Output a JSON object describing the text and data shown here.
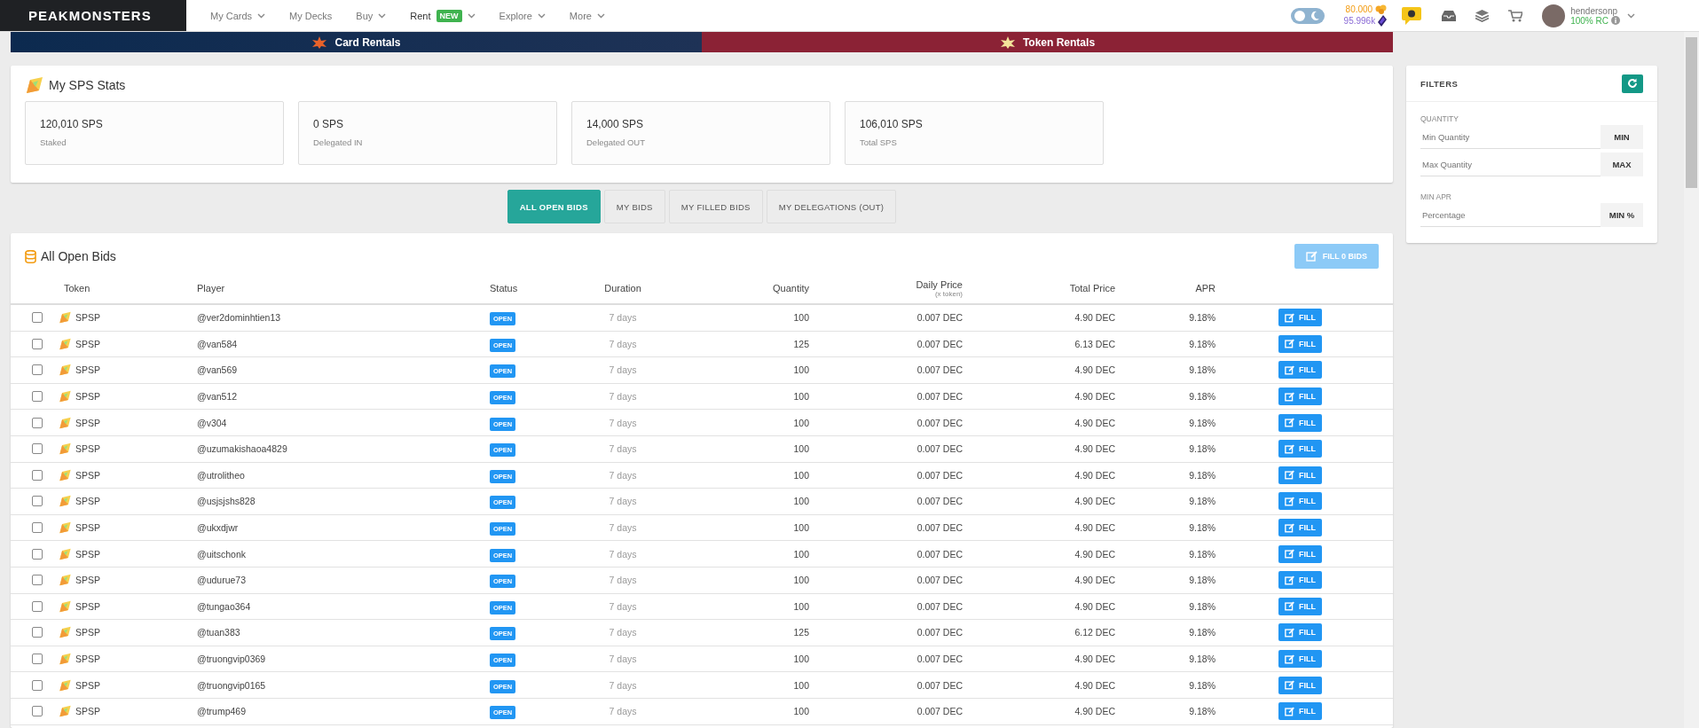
{
  "brand": {
    "name": "PEAKMONSTERS"
  },
  "nav": [
    {
      "label": "My Cards",
      "dropdown": true,
      "selected": false
    },
    {
      "label": "My Decks",
      "dropdown": false,
      "selected": false
    },
    {
      "label": "Buy",
      "dropdown": true,
      "selected": false
    },
    {
      "label": "Rent",
      "badge": "NEW",
      "dropdown": true,
      "selected": true
    },
    {
      "label": "Explore",
      "dropdown": true,
      "selected": false
    },
    {
      "label": "More",
      "dropdown": true,
      "selected": false
    }
  ],
  "header": {
    "dark_mode": false,
    "balance_primary": "80.000",
    "balance_secondary": "95.996k",
    "username": "hendersonp",
    "rc": "100% RC"
  },
  "banners": [
    {
      "label": "Card Rentals"
    },
    {
      "label": "Token Rentals"
    }
  ],
  "stats": {
    "title": "My SPS Stats",
    "items": [
      {
        "value": "120,010 SPS",
        "label": "Staked"
      },
      {
        "value": "0 SPS",
        "label": "Delegated IN"
      },
      {
        "value": "14,000 SPS",
        "label": "Delegated OUT"
      },
      {
        "value": "106,010 SPS",
        "label": "Total SPS"
      }
    ]
  },
  "tabs": [
    {
      "label": "ALL OPEN BIDS",
      "selected": true
    },
    {
      "label": "MY BIDS",
      "selected": false
    },
    {
      "label": "MY FILLED BIDS",
      "selected": false
    },
    {
      "label": "MY DELEGATIONS (OUT)",
      "selected": false
    }
  ],
  "bids": {
    "title": "All Open Bids",
    "fill_button": "FILL 0 BIDS",
    "fill_button_disabled": true,
    "columns": [
      "Token",
      "Player",
      "Status",
      "Duration",
      "Quantity",
      "Daily Price",
      "Total Price",
      "APR"
    ],
    "daily_price_note": "(x token)",
    "rows": [
      {
        "checked": false,
        "token": "SPSP",
        "player": "@ver2dominhtien13",
        "status": "OPEN",
        "duration": "7 days",
        "quantity": "100",
        "daily_price": "0.007 DEC",
        "total_price": "4.90 DEC",
        "apr": "9.18%",
        "action": "FILL"
      },
      {
        "checked": false,
        "token": "SPSP",
        "player": "@van584",
        "status": "OPEN",
        "duration": "7 days",
        "quantity": "125",
        "daily_price": "0.007 DEC",
        "total_price": "6.13 DEC",
        "apr": "9.18%",
        "action": "FILL"
      },
      {
        "checked": false,
        "token": "SPSP",
        "player": "@van569",
        "status": "OPEN",
        "duration": "7 days",
        "quantity": "100",
        "daily_price": "0.007 DEC",
        "total_price": "4.90 DEC",
        "apr": "9.18%",
        "action": "FILL"
      },
      {
        "checked": false,
        "token": "SPSP",
        "player": "@van512",
        "status": "OPEN",
        "duration": "7 days",
        "quantity": "100",
        "daily_price": "0.007 DEC",
        "total_price": "4.90 DEC",
        "apr": "9.18%",
        "action": "FILL"
      },
      {
        "checked": false,
        "token": "SPSP",
        "player": "@v304",
        "status": "OPEN",
        "duration": "7 days",
        "quantity": "100",
        "daily_price": "0.007 DEC",
        "total_price": "4.90 DEC",
        "apr": "9.18%",
        "action": "FILL"
      },
      {
        "checked": false,
        "token": "SPSP",
        "player": "@uzumakishaoa4829",
        "status": "OPEN",
        "duration": "7 days",
        "quantity": "100",
        "daily_price": "0.007 DEC",
        "total_price": "4.90 DEC",
        "apr": "9.18%",
        "action": "FILL"
      },
      {
        "checked": false,
        "token": "SPSP",
        "player": "@utrolitheo",
        "status": "OPEN",
        "duration": "7 days",
        "quantity": "100",
        "daily_price": "0.007 DEC",
        "total_price": "4.90 DEC",
        "apr": "9.18%",
        "action": "FILL"
      },
      {
        "checked": false,
        "token": "SPSP",
        "player": "@usjsjshs828",
        "status": "OPEN",
        "duration": "7 days",
        "quantity": "100",
        "daily_price": "0.007 DEC",
        "total_price": "4.90 DEC",
        "apr": "9.18%",
        "action": "FILL"
      },
      {
        "checked": false,
        "token": "SPSP",
        "player": "@ukxdjwr",
        "status": "OPEN",
        "duration": "7 days",
        "quantity": "100",
        "daily_price": "0.007 DEC",
        "total_price": "4.90 DEC",
        "apr": "9.18%",
        "action": "FILL"
      },
      {
        "checked": false,
        "token": "SPSP",
        "player": "@uitschonk",
        "status": "OPEN",
        "duration": "7 days",
        "quantity": "100",
        "daily_price": "0.007 DEC",
        "total_price": "4.90 DEC",
        "apr": "9.18%",
        "action": "FILL"
      },
      {
        "checked": false,
        "token": "SPSP",
        "player": "@udurue73",
        "status": "OPEN",
        "duration": "7 days",
        "quantity": "100",
        "daily_price": "0.007 DEC",
        "total_price": "4.90 DEC",
        "apr": "9.18%",
        "action": "FILL"
      },
      {
        "checked": false,
        "token": "SPSP",
        "player": "@tungao364",
        "status": "OPEN",
        "duration": "7 days",
        "quantity": "100",
        "daily_price": "0.007 DEC",
        "total_price": "4.90 DEC",
        "apr": "9.18%",
        "action": "FILL"
      },
      {
        "checked": false,
        "token": "SPSP",
        "player": "@tuan383",
        "status": "OPEN",
        "duration": "7 days",
        "quantity": "125",
        "daily_price": "0.007 DEC",
        "total_price": "6.12 DEC",
        "apr": "9.18%",
        "action": "FILL"
      },
      {
        "checked": false,
        "token": "SPSP",
        "player": "@truongvip0369",
        "status": "OPEN",
        "duration": "7 days",
        "quantity": "100",
        "daily_price": "0.007 DEC",
        "total_price": "4.90 DEC",
        "apr": "9.18%",
        "action": "FILL"
      },
      {
        "checked": false,
        "token": "SPSP",
        "player": "@truongvip0165",
        "status": "OPEN",
        "duration": "7 days",
        "quantity": "100",
        "daily_price": "0.007 DEC",
        "total_price": "4.90 DEC",
        "apr": "9.18%",
        "action": "FILL"
      },
      {
        "checked": false,
        "token": "SPSP",
        "player": "@trump469",
        "status": "OPEN",
        "duration": "7 days",
        "quantity": "100",
        "daily_price": "0.007 DEC",
        "total_price": "4.90 DEC",
        "apr": "9.18%",
        "action": "FILL"
      }
    ]
  },
  "filters": {
    "title": "FILTERS",
    "groups": [
      {
        "label": "QUANTITY",
        "fields": [
          {
            "placeholder": "Min Quantity",
            "button": "MIN"
          },
          {
            "placeholder": "Max Quantity",
            "button": "MAX"
          }
        ]
      },
      {
        "label": "MIN APR",
        "fields": [
          {
            "placeholder": "Percentage",
            "button": "MIN %"
          }
        ]
      }
    ]
  }
}
